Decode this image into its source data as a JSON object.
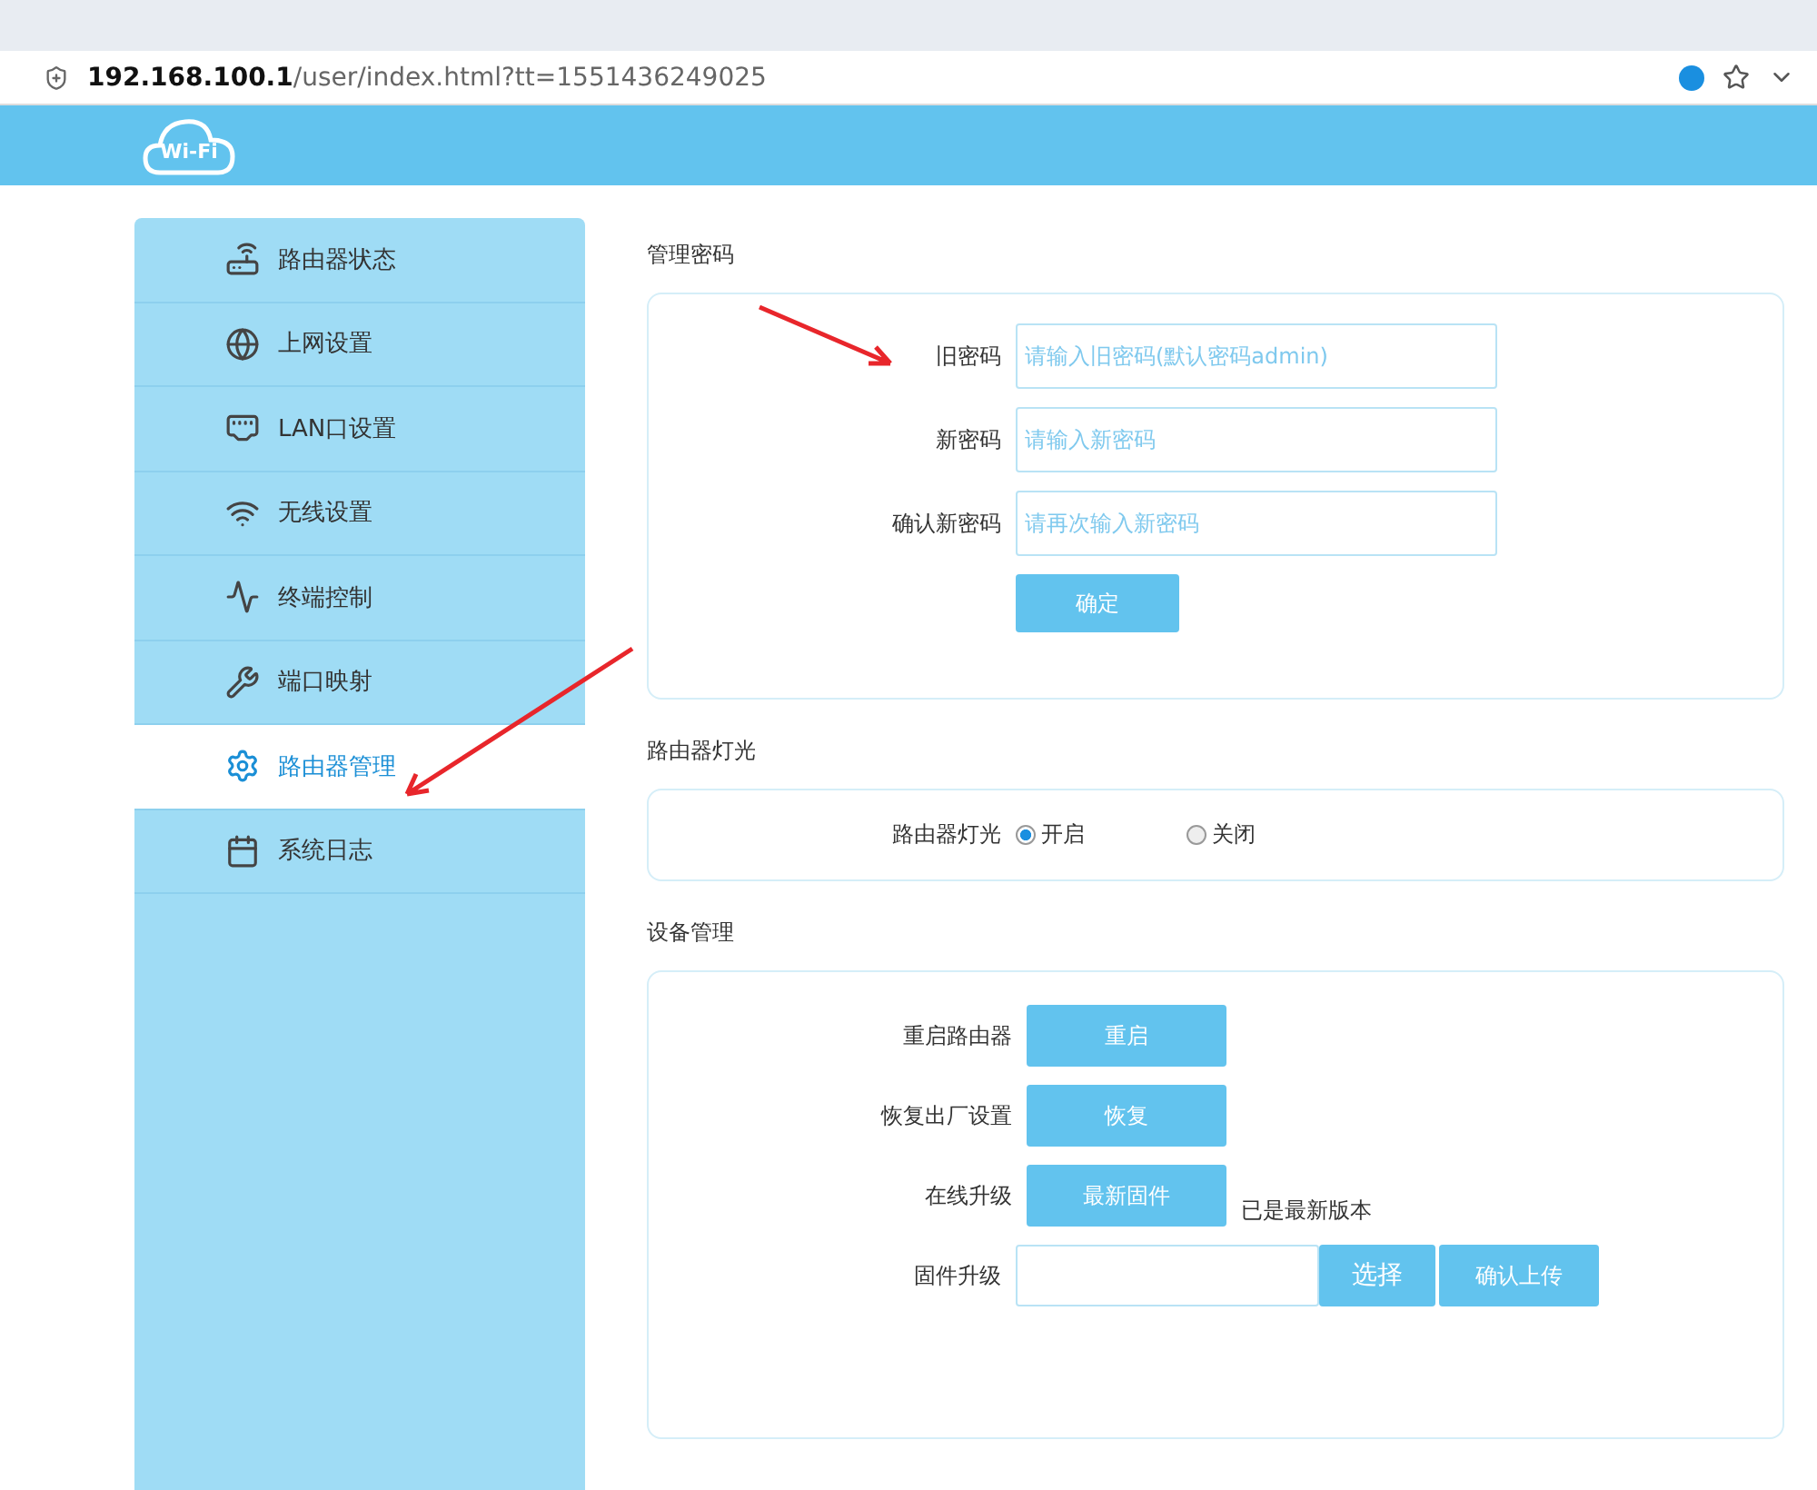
{
  "browser": {
    "url": "**192.168.100.1**/user/index.html?tt=1551436249025"
  },
  "header": {
    "logo": "Wi-Fi"
  },
  "sidebar": {
    "items": [
      {
        "label": "路由器状态",
        "selected": false
      },
      {
        "label": "上网设置",
        "selected": false
      },
      {
        "label": "LAN口设置",
        "selected": false
      },
      {
        "label": "无线设置",
        "selected": false
      },
      {
        "label": "终端控制",
        "selected": false
      },
      {
        "label": "端口映射",
        "selected": false
      },
      {
        "label": "路由器管理",
        "selected": true
      },
      {
        "label": "系统日志",
        "selected": false
      }
    ]
  },
  "password_section": {
    "title": "管理密码",
    "fields": [
      {
        "label": "旧密码",
        "placeholder": "请输入旧密码(默认密码admin)"
      },
      {
        "label": "新密码",
        "placeholder": "请输入新密码"
      },
      {
        "label": "确认新密码",
        "placeholder": "请再次输入新密码"
      }
    ],
    "submit": "确定"
  },
  "light_section": {
    "title": "路由器灯光",
    "label": "路由器灯光",
    "options": [
      {
        "label": "开启",
        "selected": true
      },
      {
        "label": "关闭",
        "selected": false
      }
    ]
  },
  "device_section": {
    "title": "设备管理",
    "rows": [
      {
        "kind": "button",
        "label": "重启路由器",
        "button": "重启"
      },
      {
        "kind": "button",
        "label": "恢复出厂设置",
        "button": "恢复"
      },
      {
        "kind": "button",
        "label": "在线升级",
        "button": "最新固件",
        "note": "已是最新版本"
      },
      {
        "kind": "upload",
        "label": "固件升级",
        "choose": "选择",
        "upload": "确认上传"
      }
    ]
  }
}
